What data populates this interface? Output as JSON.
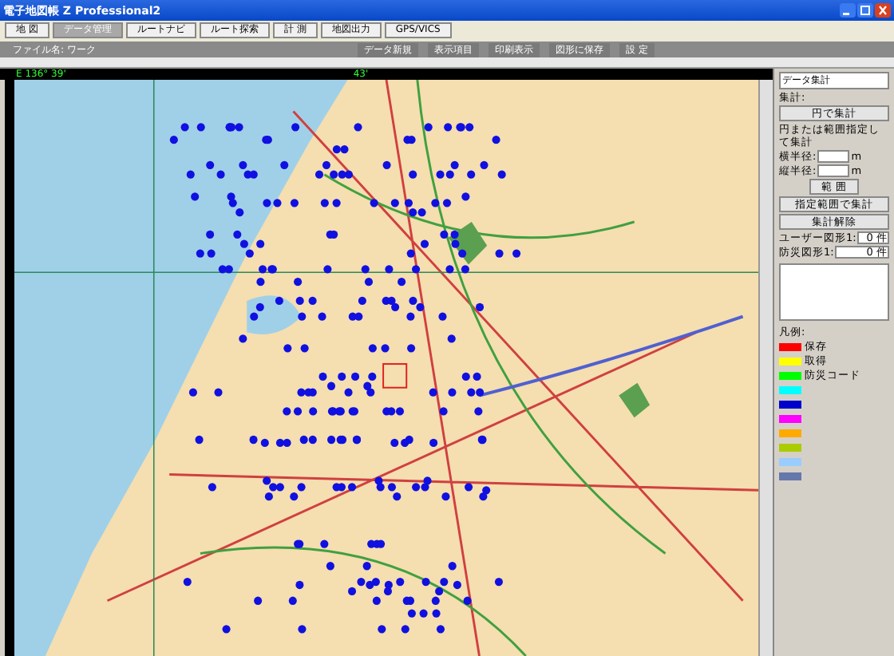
{
  "window": {
    "title": "電子地図帳 Z Professional2"
  },
  "tabs": [
    {
      "label": "地 図",
      "selected": false
    },
    {
      "label": "データ管理",
      "selected": true
    },
    {
      "label": "ルートナビ",
      "selected": false
    },
    {
      "label": "ルート探索",
      "selected": false
    },
    {
      "label": "計 測",
      "selected": false
    },
    {
      "label": "地図出力",
      "selected": false
    },
    {
      "label": "GPS/VICS",
      "selected": false
    }
  ],
  "toolbar": {
    "file_label": "ファイル名: ワーク",
    "buttons": [
      "データ新規",
      "表示項目",
      "印刷表示",
      "図形に保存",
      "設 定"
    ]
  },
  "map": {
    "coordinate": "E 136° 39'",
    "coordinate_2": "43'"
  },
  "panel": {
    "title": "データ集計",
    "summary_label": "集計:",
    "circle_button": "円で集計",
    "hint": "円または範囲指定して集計",
    "fields": [
      {
        "label": "横半径:",
        "unit": "m"
      },
      {
        "label": "縦半径:",
        "unit": "m"
      }
    ],
    "range_button": "範 囲",
    "buttons": [
      "指定範囲で集計",
      "集計解除"
    ],
    "counts": [
      {
        "label": "ユーザー図形1:",
        "value": "0 件"
      },
      {
        "label": "防災図形1:",
        "value": "0 件"
      }
    ],
    "legend_title": "凡例:",
    "legend": [
      {
        "color": "#ff0000",
        "label": "保存"
      },
      {
        "color": "#ffff00",
        "label": "取得"
      },
      {
        "color": "#00ff00",
        "label": "防災コード"
      },
      {
        "color": "#00ffff"
      },
      {
        "color": "#0000cc"
      },
      {
        "color": "#ff00ff"
      },
      {
        "color": "#ffaa00"
      },
      {
        "color": "#aacc00"
      },
      {
        "color": "#99ccff"
      },
      {
        "color": "#6677aa"
      }
    ]
  }
}
